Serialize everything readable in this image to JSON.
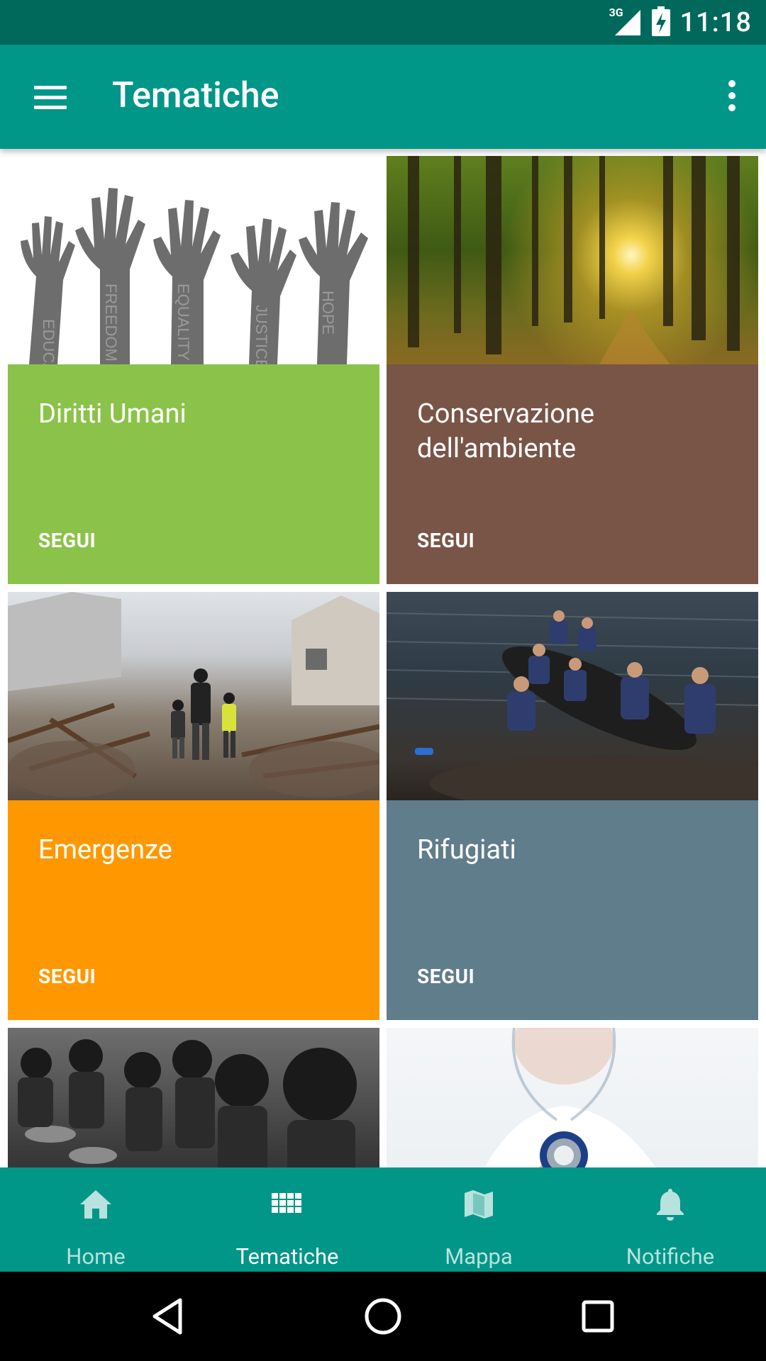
{
  "status_bar": {
    "network": "3G",
    "time": "11:18"
  },
  "app_bar": {
    "title": "Tematiche",
    "menu_icon": "hamburger-menu-icon",
    "overflow_icon": "more-vert-icon"
  },
  "cards": [
    {
      "title": "Diritti Umani",
      "action": "SEGUI",
      "color": "#8BC34A",
      "image": "raised-hands-illustration",
      "image_words": [
        "EDUCATION",
        "FREEDOM",
        "EQUALITY",
        "JUSTICE",
        "HOPE"
      ]
    },
    {
      "title": "Conservazione dell'ambiente",
      "action": "SEGUI",
      "color": "#795548",
      "image": "sunlit-forest-photo"
    },
    {
      "title": "Emergenze",
      "action": "SEGUI",
      "color": "#FF9800",
      "image": "disaster-debris-photo"
    },
    {
      "title": "Rifugiati",
      "action": "SEGUI",
      "color": "#607D8B",
      "image": "refugees-boat-photo"
    },
    {
      "title": "",
      "action": "",
      "color": "#3a3a3a",
      "image": "children-eating-photo"
    },
    {
      "title": "",
      "action": "",
      "color": "#e8eef2",
      "image": "doctor-stethoscope-photo"
    }
  ],
  "bottom_nav": {
    "items": [
      {
        "label": "Home",
        "icon": "home-icon",
        "active": false
      },
      {
        "label": "Tematiche",
        "icon": "grid-icon",
        "active": true
      },
      {
        "label": "Mappa",
        "icon": "map-icon",
        "active": false
      },
      {
        "label": "Notifiche",
        "icon": "bell-icon",
        "active": false
      }
    ]
  },
  "system_nav": {
    "back_icon": "back-triangle-icon",
    "home_icon": "home-circle-icon",
    "recents_icon": "recents-square-icon"
  },
  "colors": {
    "primary": "#009688",
    "primary_dark": "#00695C",
    "green": "#8BC34A",
    "brown": "#795548",
    "orange": "#FF9800",
    "blue_grey": "#607D8B"
  }
}
